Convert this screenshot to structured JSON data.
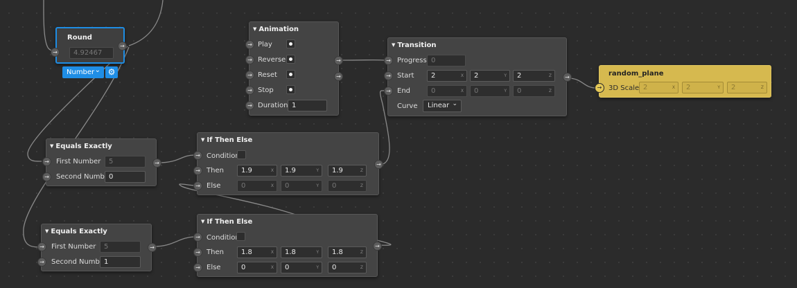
{
  "nodes": {
    "round": {
      "title": "Round",
      "value": "4.92467",
      "type_label": "Number",
      "type_chevron": "⌄",
      "gear": "⚙"
    },
    "animation": {
      "title": "Animation",
      "play": "Play",
      "reverse": "Reverse",
      "reset": "Reset",
      "stop": "Stop",
      "duration_label": "Duration",
      "duration_value": "1"
    },
    "transition": {
      "title": "Transition",
      "progress_label": "Progress",
      "progress_value": "0",
      "start_label": "Start",
      "start_values": [
        "2",
        "2",
        "2"
      ],
      "end_label": "End",
      "end_values": [
        "0",
        "0",
        "0"
      ],
      "curve_label": "Curve",
      "curve_value": "Linear",
      "curve_chevron": "⌄"
    },
    "random_plane": {
      "title": "random_plane",
      "scale_label": "3D Scale",
      "scale_values": [
        "2",
        "2",
        "2"
      ]
    },
    "equals_1": {
      "title": "Equals Exactly",
      "first_label": "First Number",
      "first_value": "5",
      "second_label": "Second Number",
      "second_value": "0"
    },
    "equals_2": {
      "title": "Equals Exactly",
      "first_label": "First Number",
      "first_value": "5",
      "second_label": "Second Number",
      "second_value": "1"
    },
    "if_1": {
      "title": "If Then Else",
      "condition_label": "Condition",
      "then_label": "Then",
      "then_values": [
        "1.9",
        "1.9",
        "1.9"
      ],
      "else_label": "Else",
      "else_values": [
        "0",
        "0",
        "0"
      ]
    },
    "if_2": {
      "title": "If Then Else",
      "condition_label": "Condition",
      "then_label": "Then",
      "then_values": [
        "1.8",
        "1.8",
        "1.8"
      ],
      "else_label": "Else",
      "else_values": [
        "0",
        "0",
        "0"
      ]
    }
  },
  "axes": [
    "X",
    "Y",
    "Z"
  ],
  "glyphs": {
    "port_arrow": "→",
    "caret": "▼"
  },
  "icons": {
    "port": "arrow-right-icon",
    "caret": "caret-down-icon",
    "trigger": "dot-icon",
    "gear": "gear-icon",
    "chevron": "chevron-down-icon"
  },
  "colors": {
    "canvas": "#2b2b2b",
    "node": "#444444",
    "selected_border": "#1e8de4",
    "type_button": "#1f8ee6",
    "object_node": "#d6b94f",
    "wire": "#8a8a8a"
  }
}
